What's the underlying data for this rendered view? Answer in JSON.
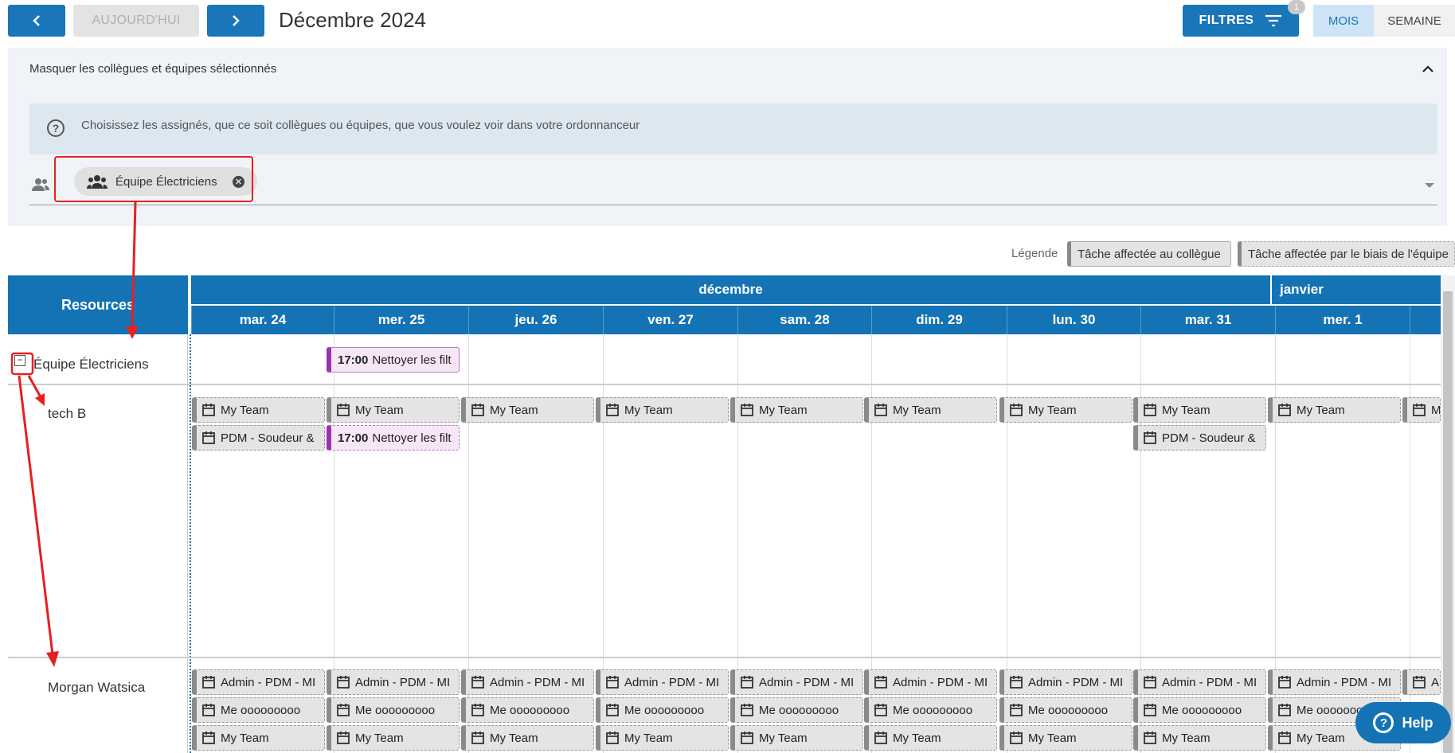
{
  "toolbar": {
    "today_label": "AUJOURD'HUI",
    "period_title": "Décembre 2024",
    "filters_label": "FILTRES",
    "filters_count": "1",
    "view_month": "MOIS",
    "view_week": "SEMAINE"
  },
  "filter_panel": {
    "header": "Masquer les collègues et équipes sélectionnés",
    "info_text": "Choisissez les assignés, que ce soit collègues ou équipes, que vous voulez voir dans votre ordonnanceur",
    "selected_chip": "Équipe Électriciens"
  },
  "legend": {
    "label": "Légende",
    "item_colleague": "Tâche affectée au collègue",
    "item_team": "Tâche affectée par le biais de l'équipe"
  },
  "scheduler": {
    "resources_header": "Resources",
    "months": [
      "décembre",
      "janvier"
    ],
    "days": [
      "mar. 24",
      "mer. 25",
      "jeu. 26",
      "ven. 27",
      "sam. 28",
      "dim. 29",
      "lun. 30",
      "mar. 31",
      "mer. 1"
    ],
    "resources": [
      "Équipe Électriciens",
      "tech B",
      "Morgan Watsica"
    ],
    "team_event": {
      "time": "17:00",
      "title": "Nettoyer les filt"
    },
    "techb_event_my_team": "My Team",
    "techb_event_pdm": "PDM - Soudeur &",
    "techb_event_nettoyer": {
      "time": "17:00",
      "title": "Nettoyer les filt"
    },
    "morgan_event_admin": "Admin - PDM - MI",
    "morgan_event_me": "Me ooooooooo",
    "morgan_event_my_team": "My Team",
    "overflow_my_team": "M",
    "overflow_admin": "A"
  },
  "help": {
    "label": "Help"
  }
}
